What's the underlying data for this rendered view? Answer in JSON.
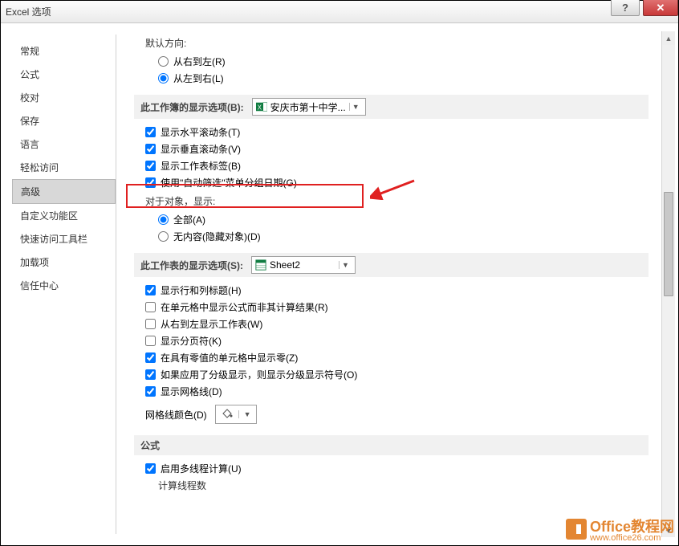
{
  "window": {
    "title": "Excel 选项"
  },
  "sidebar": {
    "items": [
      {
        "label": "常规"
      },
      {
        "label": "公式"
      },
      {
        "label": "校对"
      },
      {
        "label": "保存"
      },
      {
        "label": "语言"
      },
      {
        "label": "轻松访问"
      },
      {
        "label": "高级",
        "selected": true
      },
      {
        "label": "自定义功能区"
      },
      {
        "label": "快速访问工具栏"
      },
      {
        "label": "加载项"
      },
      {
        "label": "信任中心"
      }
    ]
  },
  "top_truncated": {
    "default_direction_label": "默认方向:",
    "rtl_label": "从右到左(R)",
    "ltr_label": "从左到右(L)"
  },
  "workbook_section": {
    "label": "此工作簿的显示选项(B):",
    "dropdown": "安庆市第十中学...",
    "chk_h_scroll": "显示水平滚动条(T)",
    "chk_v_scroll": "显示垂直滚动条(V)",
    "chk_sheet_tabs": "显示工作表标签(B)",
    "chk_autofilter_date": "使用\"自动筛选\"菜单分组日期(G)",
    "objects_label": "对于对象，显示:",
    "obj_all": "全部(A)",
    "obj_none": "无内容(隐藏对象)(D)"
  },
  "worksheet_section": {
    "label": "此工作表的显示选项(S):",
    "dropdown": "Sheet2",
    "chk_rowcol_headers": "显示行和列标题(H)",
    "chk_formulas": "在单元格中显示公式而非其计算结果(R)",
    "chk_rtl_sheet": "从右到左显示工作表(W)",
    "chk_page_breaks": "显示分页符(K)",
    "chk_zeros": "在具有零值的单元格中显示零(Z)",
    "chk_outline_symbols": "如果应用了分级显示，则显示分级显示符号(O)",
    "chk_gridlines": "显示网格线(D)",
    "gridline_color_label": "网格线颜色(D)"
  },
  "formula_section": {
    "label": "公式",
    "chk_multithread": "启用多线程计算(U)",
    "threads_label": "计算线程数"
  },
  "watermark": {
    "brand": "Office教程网",
    "url": "www.office26.com"
  }
}
